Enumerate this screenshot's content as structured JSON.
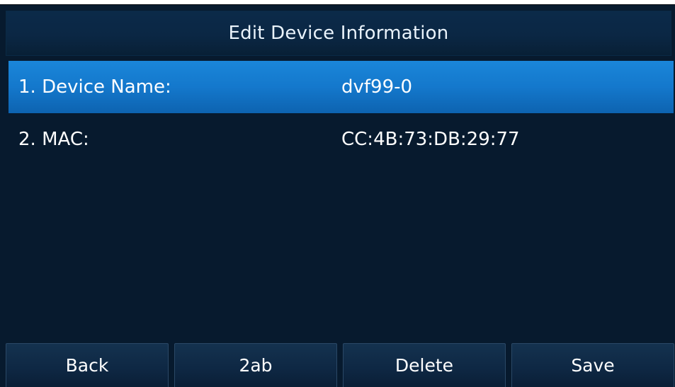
{
  "header": {
    "title": "Edit Device Information"
  },
  "fields": [
    {
      "label": "1. Device Name:",
      "value": "dvf99-0",
      "selected": true
    },
    {
      "label": "2. MAC:",
      "value": "CC:4B:73:DB:29:77",
      "selected": false
    }
  ],
  "softkeys": [
    {
      "label": "Back"
    },
    {
      "label": "2ab"
    },
    {
      "label": "Delete"
    },
    {
      "label": "Save"
    }
  ],
  "colors": {
    "background": "#071a2e",
    "selection": "#1478cc",
    "text": "#ffffff"
  }
}
